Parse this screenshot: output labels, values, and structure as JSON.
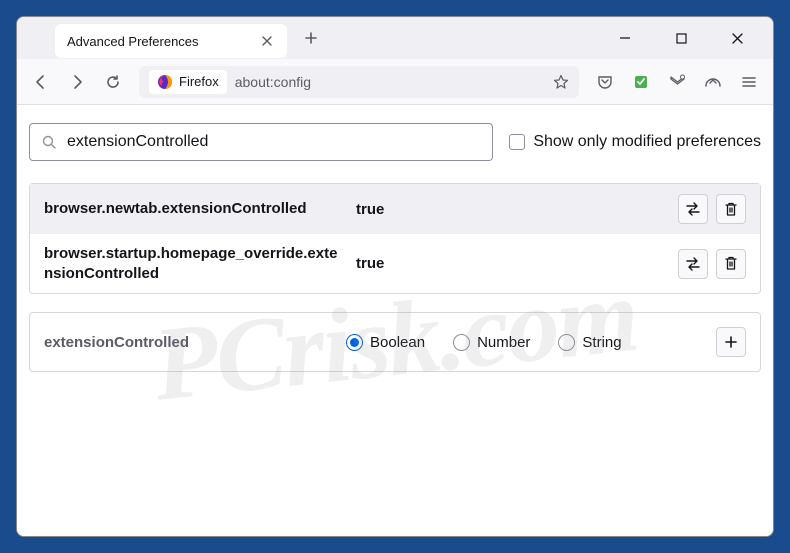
{
  "window": {
    "tab_title": "Advanced Preferences"
  },
  "toolbar": {
    "identity_label": "Firefox",
    "url": "about:config"
  },
  "search": {
    "value": "extensionControlled",
    "checkbox_label": "Show only modified preferences"
  },
  "prefs": [
    {
      "name": "browser.newtab.extensionControlled",
      "value": "true"
    },
    {
      "name": "browser.startup.homepage_override.extensionControlled",
      "value": "true"
    }
  ],
  "new_pref": {
    "name": "extensionControlled",
    "types": {
      "boolean": "Boolean",
      "number": "Number",
      "string": "String"
    },
    "selected": "boolean"
  },
  "watermark": "PCrisk.com"
}
